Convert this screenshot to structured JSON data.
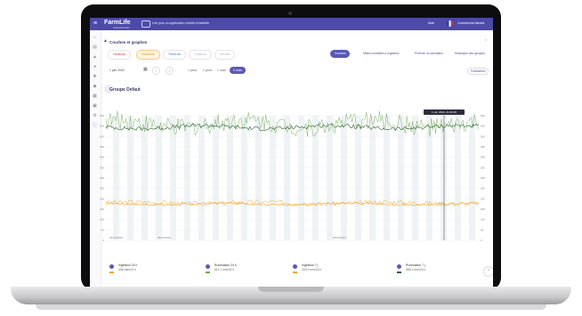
{
  "topbar": {
    "app_name": "FarmLife",
    "app_sub": "Connected Farm",
    "promo": "Lire pour un application mobile et tablette",
    "help": "Aide",
    "user": "Commercial Medria"
  },
  "section": {
    "title": "Courbes et graphes",
    "chips": [
      "HeatLive",
      "FeedLive",
      "TimeLive",
      "ColdLive",
      "IceLive"
    ],
    "actions": [
      "Courbes",
      "Mises conduites à ingestion",
      "Profil de la rumination",
      "Historique des groupes"
    ]
  },
  "datebar": {
    "date": "1 juin 2024",
    "periods": [
      "1 jours",
      "1 jours",
      "1 mois",
      "3 mois"
    ],
    "params": "Paramètres"
  },
  "group": {
    "title": "Groupe Defaut"
  },
  "tooltip": "1 juin 2024, 21:00:00",
  "chart_data": {
    "type": "line",
    "x_labels": [
      "05/12/2023",
      "05/12/2023",
      "05/03/2024"
    ],
    "y_left_ticks": [
      "600",
      "550",
      "500",
      "450",
      "400",
      "350",
      "300",
      "250",
      "200",
      "150",
      "100",
      "50",
      "0"
    ],
    "y_right_ticks": [
      "600",
      "550",
      "500",
      "450",
      "400",
      "350",
      "300",
      "250",
      "200",
      "150",
      "100",
      "50",
      "0"
    ],
    "series": [
      {
        "name": "Ingestion 24 h",
        "value": "336 min/24 h",
        "color": "#f3a521",
        "approx_level": 180
      },
      {
        "name": "Rumination 24 h",
        "value": "611.1 min/24 h",
        "color": "#6aa84f",
        "approx_level": 560
      },
      {
        "name": "Ingestion 7 j",
        "value": "333.2 min/24 h",
        "color": "#f3a521",
        "approx_level": 175
      },
      {
        "name": "Rumination 7 j",
        "value": "585.2 min/24 h",
        "color": "#2f5f2f",
        "approx_level": 545
      }
    ]
  }
}
